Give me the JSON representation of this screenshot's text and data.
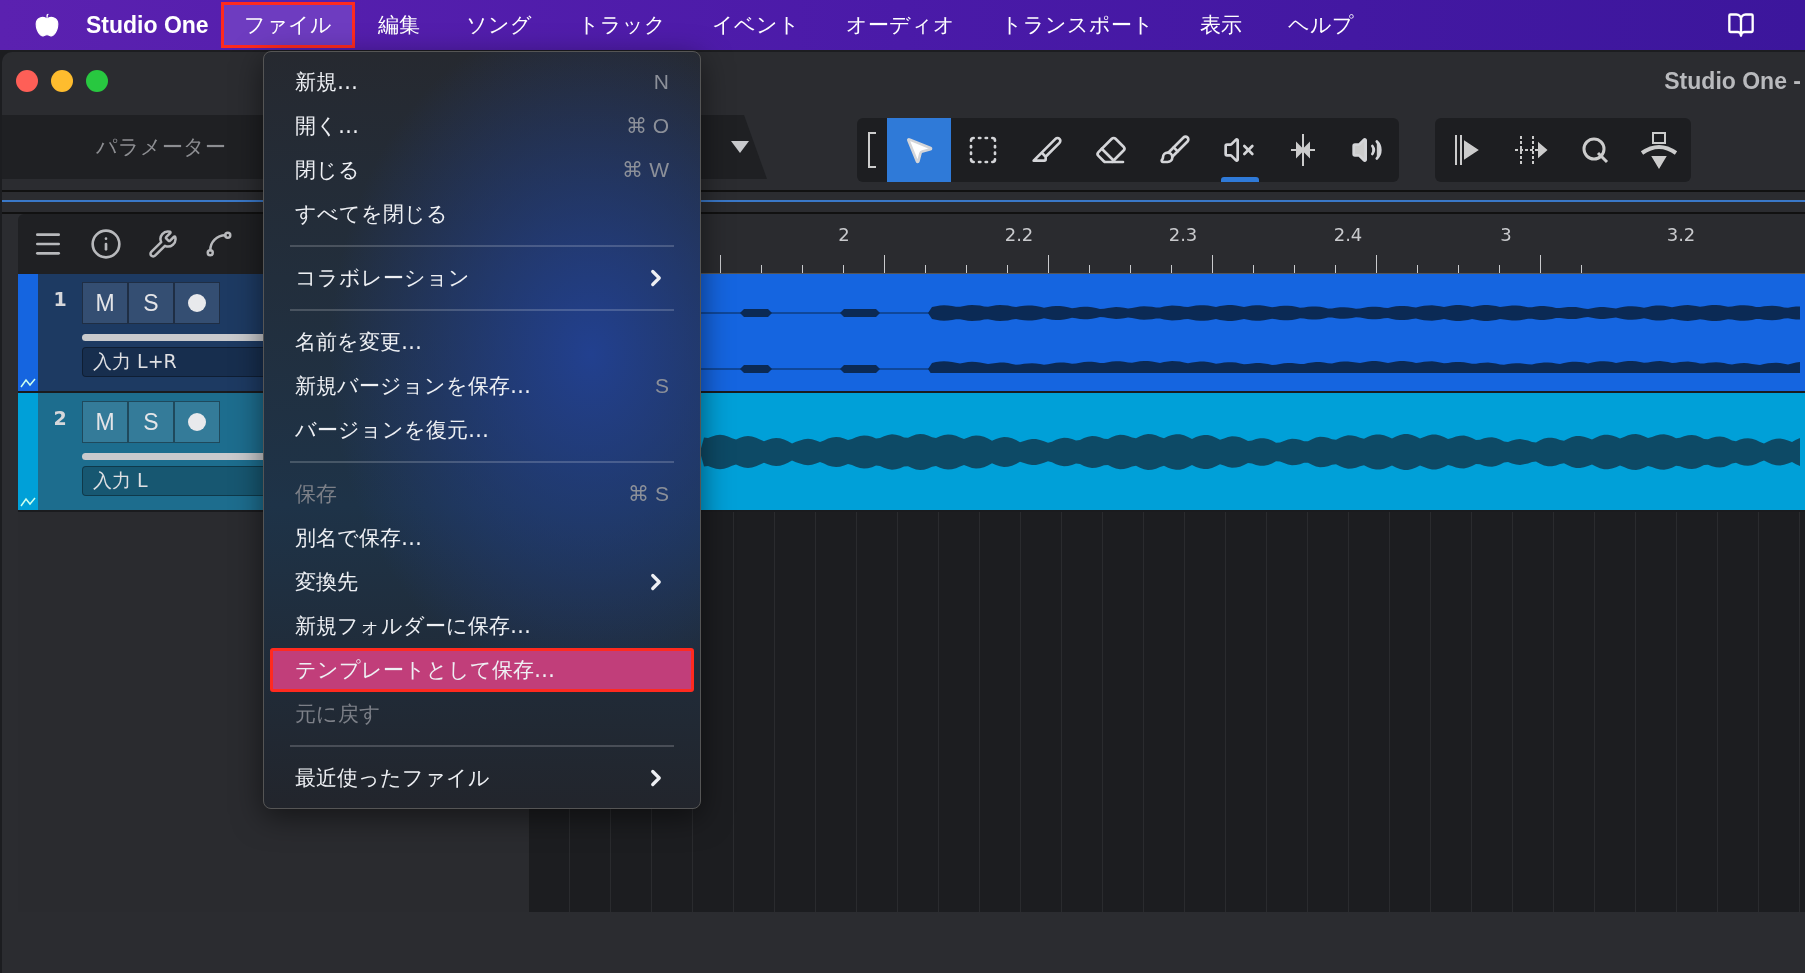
{
  "menubar": {
    "app_name": "Studio One",
    "items": [
      {
        "label": "ファイル",
        "selected": true
      },
      {
        "label": "編集",
        "selected": false
      },
      {
        "label": "ソング",
        "selected": false
      },
      {
        "label": "トラック",
        "selected": false
      },
      {
        "label": "イベント",
        "selected": false
      },
      {
        "label": "オーディオ",
        "selected": false
      },
      {
        "label": "トランスポート",
        "selected": false
      },
      {
        "label": "表示",
        "selected": false
      },
      {
        "label": "ヘルプ",
        "selected": false
      }
    ]
  },
  "window": {
    "title": "Studio One -"
  },
  "parameter_panel": {
    "label": "パラメーター"
  },
  "toolbar": {
    "groups": [
      {
        "tools": [
          {
            "kind": "bracket",
            "selected": false,
            "indicator": false
          },
          {
            "kind": "arrow",
            "selected": true,
            "indicator": false
          },
          {
            "kind": "range",
            "selected": false,
            "indicator": false
          },
          {
            "kind": "knife",
            "selected": false,
            "indicator": false
          },
          {
            "kind": "eraser",
            "selected": false,
            "indicator": false
          },
          {
            "kind": "paint",
            "selected": false,
            "indicator": false
          },
          {
            "kind": "mute",
            "selected": false,
            "indicator": true
          },
          {
            "kind": "bend",
            "selected": false,
            "indicator": false
          },
          {
            "kind": "listen",
            "selected": false,
            "indicator": false
          }
        ]
      },
      {
        "tools": [
          {
            "kind": "snap",
            "selected": false,
            "indicator": false
          },
          {
            "kind": "stretch",
            "selected": false,
            "indicator": false
          },
          {
            "kind": "quantize",
            "selected": false,
            "indicator": false
          },
          {
            "kind": "autoscroll",
            "selected": false,
            "indicator": false
          }
        ]
      }
    ]
  },
  "ruler": {
    "labels": [
      "2",
      "2.2",
      "2.3",
      "2.4",
      "3",
      "3.2"
    ]
  },
  "tracks": [
    {
      "number": "1",
      "color": "#1565e0",
      "buttons": [
        "M",
        "S"
      ],
      "input": "入力 L+R",
      "kind": "stereo"
    },
    {
      "number": "2",
      "color": "#00a0d8",
      "buttons": [
        "M",
        "S"
      ],
      "input": "入力 L",
      "kind": "mono"
    }
  ],
  "file_menu": {
    "items": [
      {
        "kind": "item",
        "label": "新規…",
        "shortcut": "N",
        "disabled": false,
        "selected": false,
        "submenu": false
      },
      {
        "kind": "item",
        "label": "開く…",
        "shortcut": "⌘ O",
        "disabled": false,
        "selected": false,
        "submenu": false
      },
      {
        "kind": "item",
        "label": "閉じる",
        "shortcut": "⌘ W",
        "disabled": false,
        "selected": false,
        "submenu": false
      },
      {
        "kind": "item",
        "label": "すべてを閉じる",
        "disabled": false,
        "selected": false,
        "submenu": false
      },
      {
        "kind": "separator"
      },
      {
        "kind": "item",
        "label": "コラボレーション",
        "disabled": false,
        "selected": false,
        "submenu": true
      },
      {
        "kind": "separator"
      },
      {
        "kind": "item",
        "label": "名前を変更…",
        "disabled": false,
        "selected": false,
        "submenu": false
      },
      {
        "kind": "item",
        "label": "新規バージョンを保存…",
        "shortcut": "S",
        "disabled": false,
        "selected": false,
        "submenu": false
      },
      {
        "kind": "item",
        "label": "バージョンを復元…",
        "disabled": false,
        "selected": false,
        "submenu": false
      },
      {
        "kind": "separator"
      },
      {
        "kind": "item",
        "label": "保存",
        "shortcut": "⌘ S",
        "disabled": true,
        "selected": false,
        "submenu": false
      },
      {
        "kind": "item",
        "label": "別名で保存…",
        "disabled": false,
        "selected": false,
        "submenu": false
      },
      {
        "kind": "item",
        "label": "変換先",
        "disabled": false,
        "selected": false,
        "submenu": true
      },
      {
        "kind": "item",
        "label": "新規フォルダーに保存…",
        "disabled": false,
        "selected": false,
        "submenu": false
      },
      {
        "kind": "item",
        "label": "テンプレートとして保存…",
        "disabled": false,
        "selected": true,
        "submenu": false
      },
      {
        "kind": "item",
        "label": "元に戻す",
        "disabled": true,
        "selected": false,
        "submenu": false
      },
      {
        "kind": "separator"
      },
      {
        "kind": "item",
        "label": "最近使ったファイル",
        "disabled": false,
        "selected": false,
        "submenu": true
      }
    ]
  }
}
